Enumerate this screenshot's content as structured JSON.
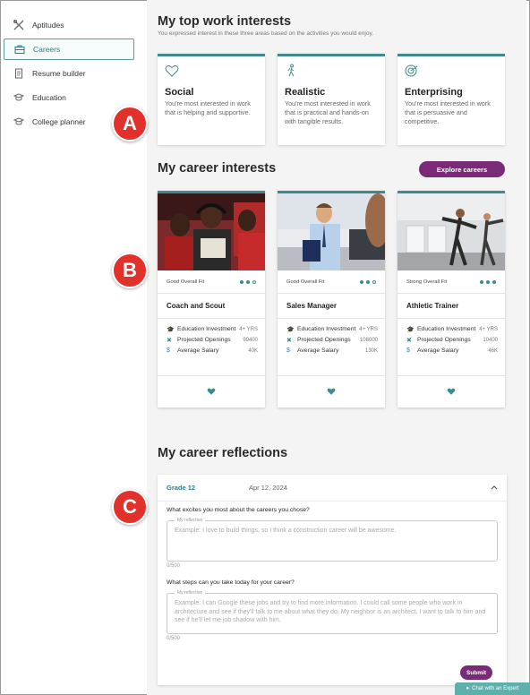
{
  "sidebar": {
    "items": [
      {
        "label": "Aptitudes",
        "icon": "tools-icon",
        "active": false
      },
      {
        "label": "Careers",
        "icon": "briefcase-icon",
        "active": true
      },
      {
        "label": "Resume builder",
        "icon": "document-icon",
        "active": false
      },
      {
        "label": "Education",
        "icon": "graduation-cap-icon",
        "active": false
      },
      {
        "label": "College planner",
        "icon": "graduation-cap-icon",
        "active": false
      }
    ]
  },
  "top_interests": {
    "title": "My top work interests",
    "subtitle": "You expressed interest in these three areas based on the activities you would enjoy.",
    "cards": [
      {
        "title": "Social",
        "description": "You're most interested in work that is helping and supportive.",
        "icon": "heart-icon"
      },
      {
        "title": "Realistic",
        "description": "You're most interested in work that is practical and hands-on with tangible results.",
        "icon": "hiker-icon"
      },
      {
        "title": "Enterprising",
        "description": "You're most interested in work that is persuasive and competitive.",
        "icon": "target-icon"
      }
    ]
  },
  "career_interests": {
    "title": "My career interests",
    "explore_label": "Explore careers",
    "cards": [
      {
        "fit": "Good Overall Fit",
        "fit_dots": 2,
        "title": "Coach and Scout",
        "education_label": "Education Investment",
        "education_value": "4+ YRS",
        "openings_label": "Projected Openings",
        "openings_value": "99400",
        "salary_label": "Average Salary",
        "salary_value": "40K"
      },
      {
        "fit": "Good Overall Fit",
        "fit_dots": 2,
        "title": "Sales Manager",
        "education_label": "Education Investment",
        "education_value": "4+ YRS",
        "openings_label": "Projected Openings",
        "openings_value": "108000",
        "salary_label": "Average Salary",
        "salary_value": "130K"
      },
      {
        "fit": "Strong Overall Fit",
        "fit_dots": 3,
        "title": "Athletic Trainer",
        "education_label": "Education Investment",
        "education_value": "4+ YRS",
        "openings_label": "Projected Openings",
        "openings_value": "10400",
        "salary_label": "Average Salary",
        "salary_value": "46K"
      }
    ]
  },
  "reflections": {
    "title": "My career reflections",
    "grade": "Grade 12",
    "date": "Apr 12, 2024",
    "q1": "What excites you most about the careers you chose?",
    "q1_legend": "My reflection",
    "q1_placeholder": "Example: I love to build things, so I think a construction career will be awesome.",
    "q1_count": "0/500",
    "q2": "What steps can you take today for your career?",
    "q2_legend": "My reflection",
    "q2_placeholder": "Example: I can Google these jobs and try to find more information. I could call some people who work in architecture and see if they'll talk to me about what they do. My neighbor is an architect, I want to talk to him and see if he'll let me job shadow with him.",
    "q2_count": "0/500",
    "submit_label": "Submit"
  },
  "chat": {
    "label": "Chat with an Expert"
  },
  "markers": {
    "a": "A",
    "b": "B",
    "c": "C"
  },
  "colors": {
    "accent": "#3f8a8f",
    "brand": "#7b2a78",
    "marker": "#e2312a"
  }
}
